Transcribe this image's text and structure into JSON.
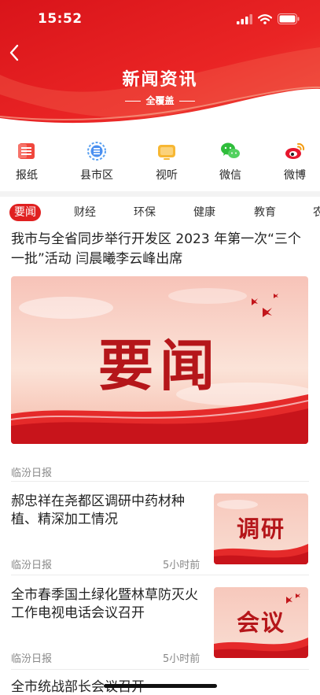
{
  "status_bar": {
    "time": "15:52"
  },
  "header": {
    "title": "新闻资讯",
    "subtitle": "全覆盖"
  },
  "quick_links": [
    {
      "label": "报纸",
      "icon": "newspaper-icon"
    },
    {
      "label": "县市区",
      "icon": "county-icon"
    },
    {
      "label": "视听",
      "icon": "tv-icon"
    },
    {
      "label": "微信",
      "icon": "wechat-icon"
    },
    {
      "label": "微博",
      "icon": "weibo-icon"
    }
  ],
  "tabs": [
    "要闻",
    "财经",
    "环保",
    "健康",
    "教育",
    "农"
  ],
  "active_tab": "要闻",
  "featured": {
    "title": "我市与全省同步举行开发区 2023 年第一次“三个一批”活动  闫晨曦李云峰出席",
    "banner_text": "要闻",
    "source": "临汾日报"
  },
  "articles": [
    {
      "title": "郝忠祥在尧都区调研中药材种植、精深加工情况",
      "source": "临汾日报",
      "time": "5小时前",
      "thumb_text": "调研"
    },
    {
      "title": "全市春季国土绿化暨林草防灭火工作电视电话会议召开",
      "source": "临汾日报",
      "time": "5小时前",
      "thumb_text": "会议"
    },
    {
      "title": "全市统战部长会议召开"
    }
  ],
  "colors": {
    "accent": "#e02020",
    "hero_red": "#e31b1b",
    "headline_red": "#b5161a"
  }
}
